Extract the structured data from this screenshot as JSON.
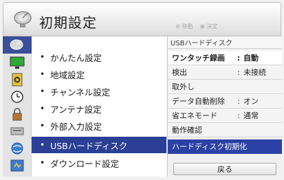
{
  "header": {
    "title": "初期設定",
    "icon": "satellite-dish-icon",
    "hints": [
      {
        "icon": "move-icon",
        "symbol": "⊕",
        "label": "移動"
      },
      {
        "icon": "enter-icon",
        "symbol": "◉",
        "label": "決定"
      }
    ]
  },
  "icon_column": [
    {
      "name": "dish-icon",
      "selected": true
    },
    {
      "name": "tv-icon",
      "selected": false
    },
    {
      "name": "sound-icon",
      "selected": false
    },
    {
      "name": "clock-icon",
      "selected": false
    },
    {
      "name": "lock-icon",
      "selected": false
    },
    {
      "name": "input-icon",
      "selected": false
    },
    {
      "name": "network-icon",
      "selected": false
    },
    {
      "name": "setup-icon",
      "selected": false
    }
  ],
  "menu": {
    "bullet": "•",
    "items": [
      {
        "label": "かんたん設定"
      },
      {
        "label": "地域設定"
      },
      {
        "label": "チャンネル設定"
      },
      {
        "label": "アンテナ設定"
      },
      {
        "label": "外部入力設定"
      },
      {
        "label": "USBハードディスク"
      },
      {
        "label": "ダウンロード設定"
      }
    ],
    "selected_index": 5
  },
  "submenu": {
    "title": "USBハードディスク",
    "items": [
      {
        "label": "ワンタッチ録画",
        "sep": ":",
        "value": "自動"
      },
      {
        "label": "検出",
        "sep": ":",
        "value": "未接続"
      },
      {
        "label": "取外し",
        "sep": "",
        "value": ""
      },
      {
        "label": "データ自動削除",
        "sep": ":",
        "value": "オン"
      },
      {
        "label": "省エネモード",
        "sep": ":",
        "value": "通常"
      },
      {
        "label": "動作確認",
        "sep": "",
        "value": ""
      },
      {
        "label": "ハードディスク初期化",
        "sep": "",
        "value": ""
      }
    ],
    "selected_index": 6,
    "back_label": "戻る"
  },
  "colors": {
    "selection": "#2a3f95",
    "submenu_selection": "#2c41a5"
  }
}
